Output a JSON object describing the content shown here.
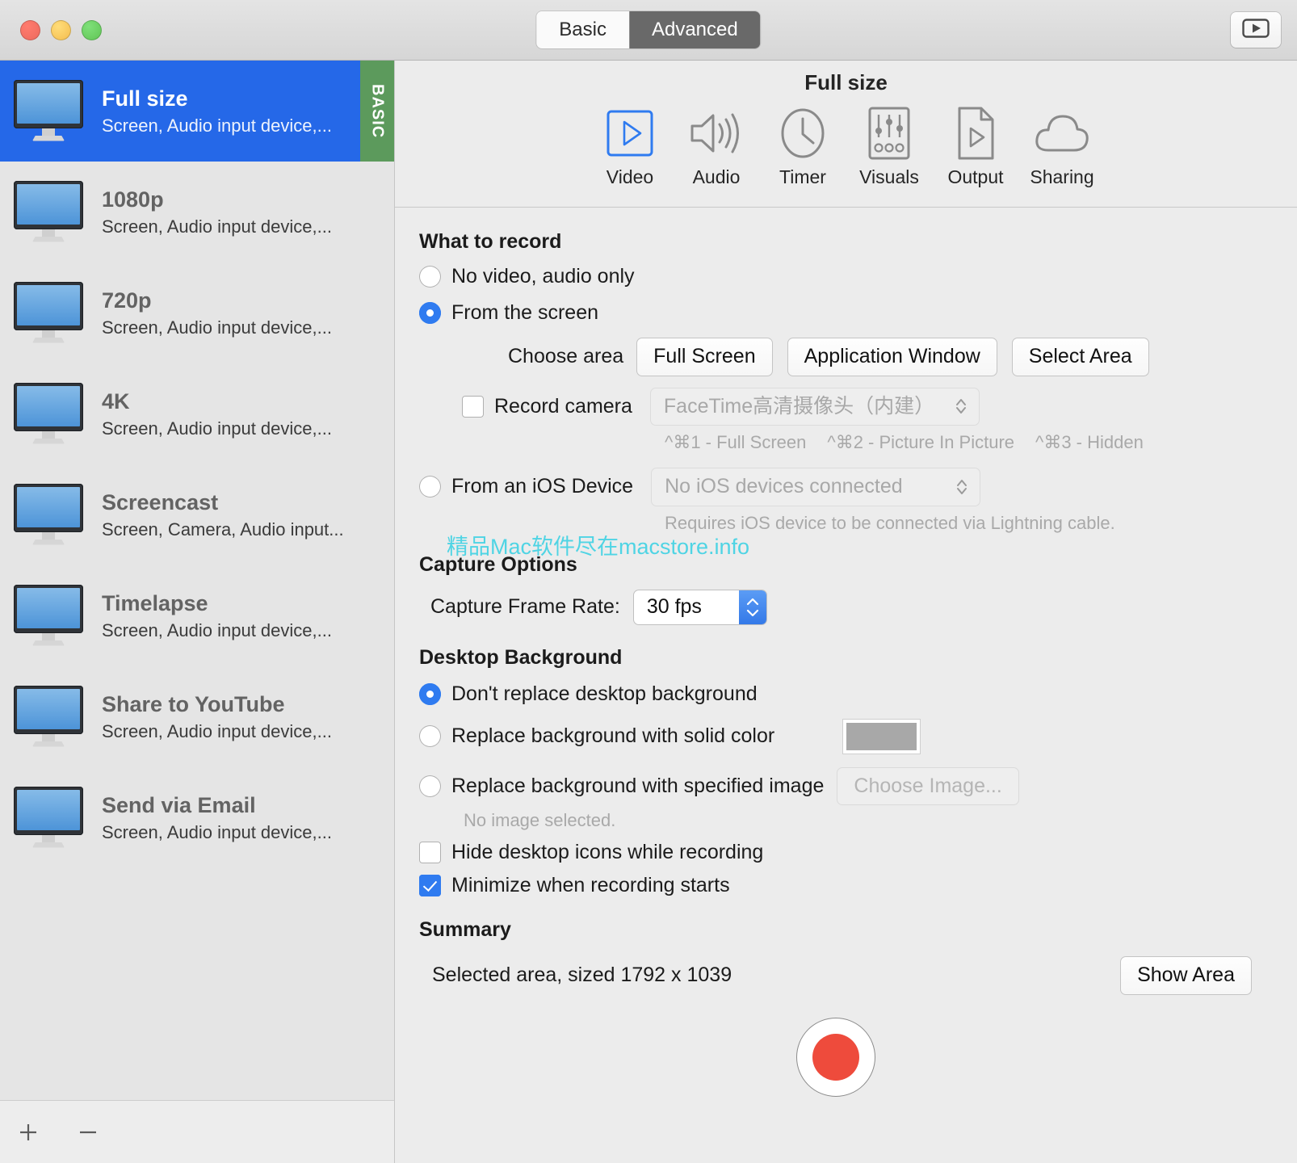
{
  "titlebar": {
    "segments": [
      {
        "label": "Basic",
        "active": false
      },
      {
        "label": "Advanced",
        "active": true
      }
    ],
    "play_button_icon": "video-play-icon"
  },
  "sidebar": {
    "presets": [
      {
        "title": "Full size",
        "subtitle": "Screen, Audio input device,...",
        "selected": true,
        "badge": "BASIC"
      },
      {
        "title": "1080p",
        "subtitle": "Screen, Audio input device,...",
        "selected": false,
        "badge": ""
      },
      {
        "title": "720p",
        "subtitle": "Screen, Audio input device,...",
        "selected": false,
        "badge": ""
      },
      {
        "title": "4K",
        "subtitle": "Screen, Audio input device,...",
        "selected": false,
        "badge": ""
      },
      {
        "title": "Screencast",
        "subtitle": "Screen, Camera, Audio input...",
        "selected": false,
        "badge": ""
      },
      {
        "title": "Timelapse",
        "subtitle": "Screen, Audio input device,...",
        "selected": false,
        "badge": ""
      },
      {
        "title": "Share to YouTube",
        "subtitle": "Screen, Audio input device,...",
        "selected": false,
        "badge": ""
      },
      {
        "title": "Send via Email",
        "subtitle": "Screen, Audio input device,...",
        "selected": false,
        "badge": ""
      }
    ],
    "footer": {
      "add_label": "+",
      "remove_label": "−"
    }
  },
  "main": {
    "title": "Full size",
    "toolbar": [
      {
        "label": "Video",
        "icon": "video-play-icon",
        "selected": true
      },
      {
        "label": "Audio",
        "icon": "speaker-icon",
        "selected": false
      },
      {
        "label": "Timer",
        "icon": "clock-icon",
        "selected": false
      },
      {
        "label": "Visuals",
        "icon": "sliders-icon",
        "selected": false
      },
      {
        "label": "Output",
        "icon": "document-play-icon",
        "selected": false
      },
      {
        "label": "Sharing",
        "icon": "cloud-icon",
        "selected": false
      }
    ],
    "what_to_record": {
      "heading": "What to record",
      "option_audio_only": {
        "label": "No video, audio only",
        "selected": false
      },
      "option_from_screen": {
        "label": "From the screen",
        "selected": true
      },
      "choose_area_label": "Choose area",
      "area_buttons": [
        "Full Screen",
        "Application Window",
        "Select Area"
      ],
      "record_camera": {
        "label": "Record camera",
        "checked": false
      },
      "camera_select_value": "FaceTime高清摄像头（内建）",
      "camera_shortcuts": [
        "^⌘1 - Full Screen",
        "^⌘2 - Picture In Picture",
        "^⌘3 - Hidden"
      ],
      "option_ios_device": {
        "label": "From an iOS Device",
        "selected": false
      },
      "ios_select_value": "No iOS devices connected",
      "ios_hint": "Requires iOS device to be connected via Lightning cable."
    },
    "capture_options": {
      "heading": "Capture Options",
      "frame_rate_label": "Capture Frame Rate:",
      "frame_rate_value": "30 fps"
    },
    "desktop_background": {
      "heading": "Desktop Background",
      "option_dont_replace": {
        "label": "Don't replace desktop background",
        "selected": true
      },
      "option_solid_color": {
        "label": "Replace background with solid color",
        "selected": false
      },
      "solid_color_swatch": "#a8a8a8",
      "option_specified_image": {
        "label": "Replace background with specified image",
        "selected": false
      },
      "choose_image_button": "Choose Image...",
      "no_image_text": "No image selected.",
      "hide_icons": {
        "label": "Hide desktop icons while recording",
        "checked": false
      },
      "minimize_on_start": {
        "label": "Minimize when recording starts",
        "checked": true
      }
    },
    "summary": {
      "heading": "Summary",
      "text": "Selected area, sized 1792 x 1039",
      "show_area_button": "Show Area"
    },
    "record_button_label": "record-button"
  },
  "watermark": {
    "text": "精品Mac软件尽在macstore.info",
    "color": "#4fd4e4"
  }
}
